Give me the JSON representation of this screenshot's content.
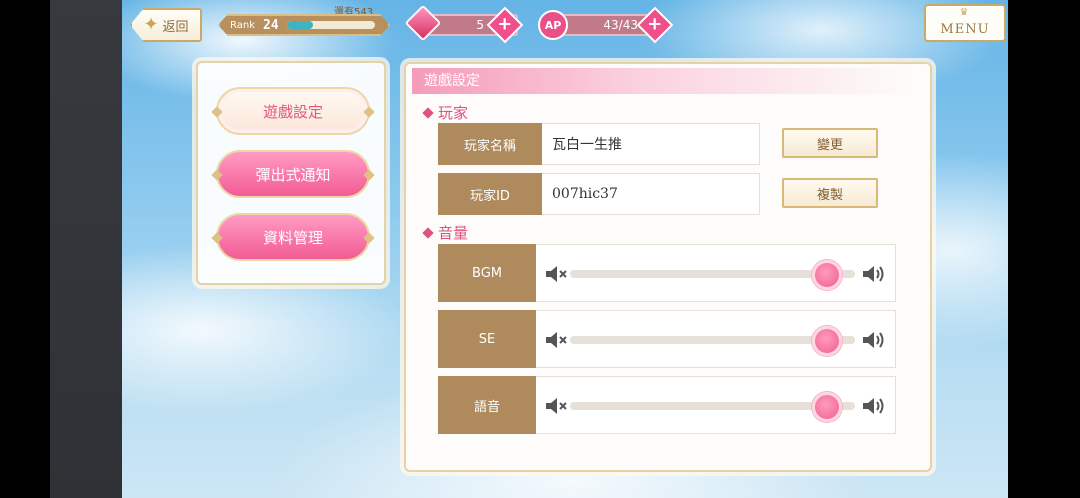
{
  "header": {
    "back_label": "返回",
    "rank_label": "Rank",
    "rank_value": "24",
    "rank_progress": 0.3,
    "rank_note": "還有543",
    "gems": "5",
    "ap_label": "AP",
    "ap_value": "43/43",
    "menu_label": "MENU"
  },
  "sidebar": {
    "items": [
      {
        "label": "遊戲設定",
        "active": true
      },
      {
        "label": "彈出式通知",
        "active": false
      },
      {
        "label": "資料管理",
        "active": false
      }
    ]
  },
  "panel": {
    "title": "遊戲設定",
    "player_section": "玩家",
    "name_label": "玩家名稱",
    "name_value": "瓦白一生推",
    "change_button": "變更",
    "id_label": "玩家ID",
    "id_value": "007hic37",
    "copy_button": "複製",
    "volume_section": "音量",
    "volumes": [
      {
        "label": "BGM",
        "level": 0.9
      },
      {
        "label": "SE",
        "level": 0.9
      },
      {
        "label": "語音",
        "level": 0.9
      }
    ]
  },
  "colors": {
    "accent_pink": "#e0517f",
    "label_brown": "#ae8a5c",
    "gold_border": "#d9b87a"
  }
}
